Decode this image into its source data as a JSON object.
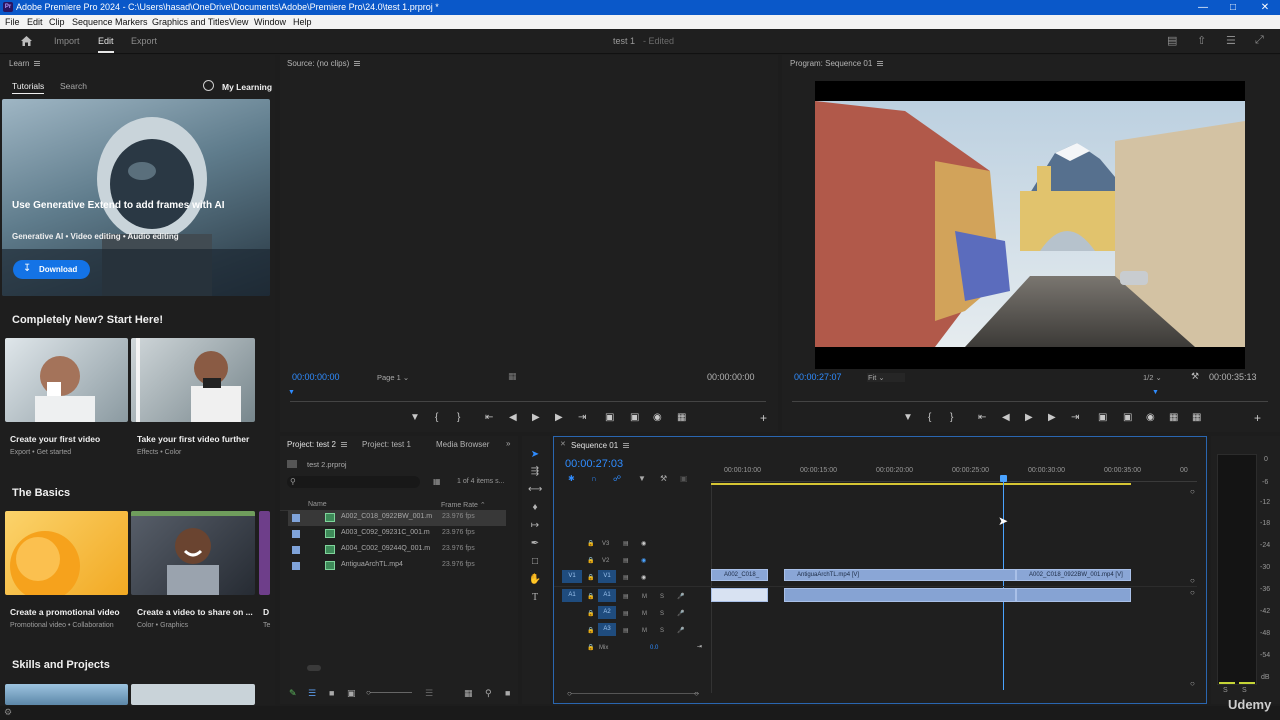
{
  "window": {
    "title": "Adobe Premiere Pro 2024 - C:\\Users\\hasad\\OneDrive\\Documents\\Adobe\\Premiere Pro\\24.0\\test 1.prproj *",
    "app_icon": "Pr"
  },
  "menu": [
    "File",
    "Edit",
    "Clip",
    "Sequence",
    "Markers",
    "Graphics and Titles",
    "View",
    "Window",
    "Help"
  ],
  "header": {
    "tabs": [
      "Import",
      "Edit",
      "Export"
    ],
    "active_tab": "Edit",
    "project_name": "test 1",
    "project_status": "- Edited"
  },
  "learn": {
    "panel_title": "Learn",
    "tabs": [
      "Tutorials",
      "Search"
    ],
    "my_learning": "My Learning",
    "hero": {
      "title": "Use Generative Extend to add frames with AI",
      "tags": "Generative AI • Video editing • Audio editing",
      "button": "Download"
    },
    "sections": [
      {
        "title": "Completely New? Start Here!",
        "cards": [
          {
            "title": "Create your first video",
            "sub": "Export • Get started"
          },
          {
            "title": "Take your first video further",
            "sub": "Effects • Color"
          }
        ]
      },
      {
        "title": "The Basics",
        "cards": [
          {
            "title": "Create a promotional video",
            "sub": "Promotional video • Collaboration"
          },
          {
            "title": "Create a video to share on ...",
            "sub": "Color • Graphics"
          },
          {
            "title": "D",
            "sub": "Te"
          }
        ]
      },
      {
        "title": "Skills and Projects",
        "cards": []
      }
    ]
  },
  "source": {
    "title": "Source: (no clips)",
    "timecode_in": "00:00:00:00",
    "page": "Page 1",
    "timecode_out": "00:00:00:00"
  },
  "program": {
    "title": "Program: Sequence 01",
    "timecode": "00:00:27:07",
    "fit": "Fit",
    "resolution": "1/2",
    "duration": "00:00:35:13"
  },
  "project": {
    "tabs": [
      "Project: test 2",
      "Project: test 1",
      "Media Browser"
    ],
    "file": "test 2.prproj",
    "items_count": "1 of 4 items s...",
    "columns": {
      "name": "Name",
      "frame_rate": "Frame Rate"
    },
    "files": [
      {
        "name": "A002_C018_0922BW_001.m",
        "fps": "23.976 fps"
      },
      {
        "name": "A003_C092_09231C_001.m",
        "fps": "23.976 fps"
      },
      {
        "name": "A004_C002_09244Q_001.m",
        "fps": "23.976 fps"
      },
      {
        "name": "AntiguaArchTL.mp4",
        "fps": "23.976 fps"
      }
    ]
  },
  "timeline": {
    "title": "Sequence 01",
    "timecode": "00:00:27:03",
    "ruler": [
      "00:00:10:00",
      "00:00:15:00",
      "00:00:20:00",
      "00:00:25:00",
      "00:00:30:00",
      "00:00:35:00",
      "00"
    ],
    "video_tracks": [
      "V3",
      "V2",
      "V1"
    ],
    "audio_tracks": [
      "A1",
      "A2",
      "A3"
    ],
    "source_patch_v": "V1",
    "source_patch_a": "A1",
    "mix_label": "Mix",
    "mix_value": "0.0",
    "track_toggle_m": "M",
    "track_toggle_s": "S",
    "clips": [
      {
        "name": "A002_C018_"
      },
      {
        "name": "AntiguaArchTL.mp4 [V]"
      },
      {
        "name": "A002_C018_0922BW_001.mp4 [V]"
      }
    ]
  },
  "meter": {
    "scale": [
      "0",
      "-6",
      "-12",
      "-18",
      "-24",
      "-30",
      "-36",
      "-42",
      "-48",
      "-54",
      "dB"
    ],
    "solo": "S"
  },
  "watermark": "Udemy",
  "colors": {
    "accent": "#2f8cff",
    "titlebar": "#0a58c9",
    "clip": "#8aa6d6",
    "playhead": "#4aa3ff"
  }
}
